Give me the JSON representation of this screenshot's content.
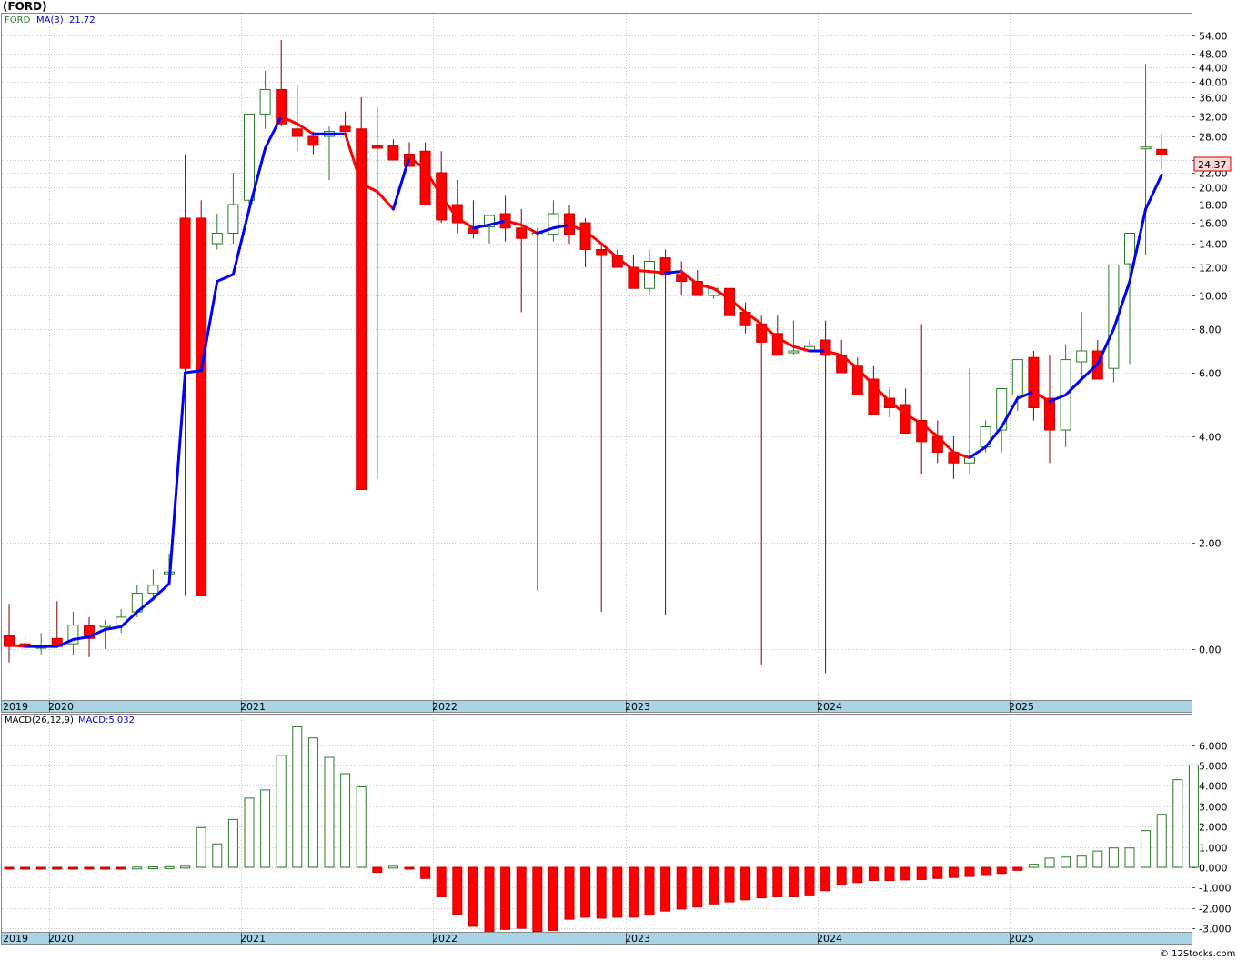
{
  "header": {
    "symbol": "(FORD)"
  },
  "legend": {
    "ticker": "FORD",
    "ma_label": "MA(3)",
    "ma_value": "21.72",
    "macd_params": "MACD(26,12,9)",
    "macd_value": "MACD:5.032"
  },
  "last_price": "24.37",
  "watermark": "© 12Stocks.com",
  "colors": {
    "up": "#2a7a2a",
    "down": "#ff0000",
    "ma_up": "#0000ff",
    "ma_down": "#ff0000",
    "axis_band": "#a8d4e6"
  },
  "chart_data": [
    {
      "type": "candlestick",
      "title": "(FORD)",
      "price_ticks": [
        "54.00",
        "48.00",
        "44.00",
        "40.00",
        "36.00",
        "32.00",
        "28.00",
        "24.00",
        "22.00",
        "20.00",
        "18.00",
        "16.00",
        "14.00",
        "12.00",
        "10.00",
        "8.00",
        "6.00",
        "4.00",
        "2.00",
        "0.00"
      ],
      "price_tick_values": [
        54,
        48,
        44,
        40,
        36,
        32,
        28,
        24,
        22,
        20,
        18,
        16,
        14,
        12,
        10,
        8,
        6,
        4,
        2,
        0
      ],
      "year_labels": [
        {
          "label": "2019",
          "month": 0
        },
        {
          "label": "2020",
          "month": 3
        },
        {
          "label": "2021",
          "month": 15
        },
        {
          "label": "2022",
          "month": 27
        },
        {
          "label": "2023",
          "month": 39
        },
        {
          "label": "2024",
          "month": 51
        },
        {
          "label": "2025",
          "month": 63
        }
      ],
      "x_range": [
        "2019-10",
        "2025-10"
      ],
      "months": [
        "2019-10",
        "2019-11",
        "2019-12",
        "2020-01",
        "2020-02",
        "2020-03",
        "2020-04",
        "2020-05",
        "2020-06",
        "2020-07",
        "2020-08",
        "2020-09",
        "2020-10",
        "2020-11",
        "2020-12",
        "2021-01",
        "2021-02",
        "2021-03",
        "2021-04",
        "2021-05",
        "2021-06",
        "2021-07",
        "2021-08",
        "2021-09",
        "2021-10",
        "2021-11",
        "2021-12",
        "2022-01",
        "2022-02",
        "2022-03",
        "2022-04",
        "2022-05",
        "2022-06",
        "2022-07",
        "2022-08",
        "2022-09",
        "2022-10",
        "2022-11",
        "2022-12",
        "2023-01",
        "2023-02",
        "2023-03",
        "2023-04",
        "2023-05",
        "2023-06",
        "2023-07",
        "2023-08",
        "2023-09",
        "2023-10",
        "2023-11",
        "2023-12",
        "2024-01",
        "2024-02",
        "2024-03",
        "2024-04",
        "2024-05",
        "2024-06",
        "2024-07",
        "2024-08",
        "2024-09",
        "2024-10",
        "2024-11",
        "2024-12",
        "2025-01",
        "2025-02",
        "2025-03",
        "2025-04",
        "2025-05",
        "2025-06",
        "2025-07",
        "2025-08",
        "2025-09",
        "2025-10"
      ],
      "open": [
        0.25,
        0.1,
        0.05,
        0.2,
        0.1,
        0.45,
        0.45,
        0.45,
        0.7,
        1.05,
        1.45,
        16.5,
        16.5,
        14.0,
        15.0,
        18.5,
        32.5,
        38.0,
        29.5,
        28.0,
        28.0,
        30.0,
        29.5,
        26.5,
        26.5,
        25.0,
        25.5,
        22.0,
        18.0,
        15.5,
        15.6,
        17.0,
        15.5,
        15.0,
        14.9,
        17.0,
        16.0,
        13.5,
        13.0,
        12.0,
        10.5,
        12.8,
        11.5,
        11.0,
        10.0,
        10.5,
        9.0,
        8.3,
        7.8,
        7.0,
        7.0,
        7.5,
        6.8,
        6.3,
        5.8,
        5.2,
        5.0,
        4.5,
        4.0,
        3.7,
        3.5,
        3.8,
        4.2,
        5.3,
        6.7,
        5.2,
        4.2,
        6.5,
        7.0,
        6.2,
        12.3,
        26.0,
        25.8
      ],
      "high": [
        0.85,
        0.25,
        0.3,
        0.9,
        0.7,
        0.6,
        0.55,
        0.75,
        1.2,
        1.5,
        1.8,
        25.0,
        18.5,
        17.0,
        22.0,
        31.0,
        43.0,
        52.5,
        39.0,
        29.0,
        30.0,
        33.0,
        36.0,
        34.0,
        27.5,
        27.0,
        27.0,
        25.5,
        21.0,
        18.5,
        16.8,
        19.0,
        17.5,
        15.5,
        18.5,
        18.0,
        16.5,
        14.0,
        13.5,
        13.0,
        13.5,
        13.5,
        12.5,
        11.8,
        10.5,
        10.5,
        9.6,
        8.8,
        8.8,
        8.5,
        7.5,
        8.5,
        7.5,
        6.7,
        6.3,
        5.5,
        5.5,
        8.3,
        4.5,
        4.0,
        6.2,
        4.5,
        4.6,
        6.5,
        7.0,
        6.8,
        7.3,
        9.0,
        7.5,
        6.8,
        12.5,
        45.0,
        28.5
      ],
      "low": [
        -0.25,
        0.0,
        -0.1,
        0.1,
        -0.1,
        -0.15,
        0.0,
        0.3,
        0.6,
        0.9,
        1.2,
        1.0,
        1.8,
        13.5,
        14.0,
        18.0,
        29.5,
        30.0,
        25.5,
        25.0,
        21.0,
        28.0,
        27.0,
        3.2,
        25.0,
        24.5,
        22.5,
        16.0,
        15.0,
        14.5,
        14.0,
        14.2,
        9.0,
        1.1,
        14.2,
        14.0,
        12.0,
        0.7,
        12.0,
        11.0,
        10.0,
        0.65,
        10.0,
        10.2,
        9.8,
        9.0,
        7.8,
        -0.3,
        7.0,
        6.8,
        7.0,
        -0.45,
        6.0,
        6.0,
        4.8,
        4.6,
        4.3,
        3.3,
        3.5,
        3.2,
        3.3,
        3.7,
        3.7,
        4.8,
        4.5,
        3.5,
        3.8,
        5.8,
        6.2,
        5.7,
        6.4,
        13.0,
        22.5
      ],
      "close": [
        0.05,
        0.05,
        0.05,
        0.05,
        0.45,
        0.2,
        0.45,
        0.6,
        1.05,
        1.2,
        1.45,
        6.2,
        1.0,
        15.0,
        18.0,
        32.5,
        38.0,
        30.5,
        28.0,
        26.5,
        29.0,
        29.0,
        3.0,
        26.0,
        24.0,
        23.0,
        18.0,
        16.3,
        16.0,
        15.0,
        16.8,
        15.5,
        14.5,
        15.0,
        17.0,
        14.9,
        13.5,
        13.0,
        12.0,
        10.5,
        12.5,
        11.5,
        11.0,
        10.0,
        10.5,
        8.8,
        8.2,
        7.4,
        6.8,
        7.0,
        7.2,
        6.8,
        6.0,
        5.3,
        4.7,
        4.9,
        4.1,
        3.9,
        3.7,
        3.5,
        3.6,
        4.3,
        5.5,
        6.6,
        4.9,
        4.2,
        6.6,
        7.0,
        5.8,
        12.2,
        15.0,
        26.2,
        25.0
      ],
      "ma": [
        0.08,
        0.05,
        0.05,
        0.05,
        0.18,
        0.23,
        0.37,
        0.42,
        0.7,
        0.95,
        1.23,
        6.0,
        6.1,
        11.0,
        11.5,
        17.5,
        26.0,
        32.0,
        30.5,
        28.5,
        28.5,
        28.5,
        20.5,
        19.5,
        17.5,
        24.5,
        22.5,
        19.0,
        16.5,
        15.5,
        15.8,
        16.2,
        15.8,
        15.0,
        15.5,
        15.8,
        15.2,
        14.0,
        12.8,
        11.8,
        11.7,
        11.6,
        11.7,
        10.8,
        10.5,
        9.8,
        9.0,
        8.3,
        7.6,
        7.2,
        7.0,
        7.0,
        6.8,
        6.2,
        5.6,
        5.1,
        4.7,
        4.4,
        4.0,
        3.7,
        3.6,
        3.8,
        4.3,
        5.2,
        5.4,
        5.1,
        5.3,
        5.8,
        6.4,
        8.0,
        11.0,
        17.5,
        21.72
      ]
    },
    {
      "type": "bar",
      "title": "MACD(26,12,9)",
      "ticks": [
        "6.000",
        "5.000",
        "4.000",
        "3.000",
        "2.000",
        "1.000",
        "0.000",
        "-1.000",
        "-2.000",
        "-3.000"
      ],
      "tick_values": [
        6,
        5,
        4,
        3,
        2,
        1,
        0,
        -1,
        -2,
        -3
      ],
      "ylim": [
        -3.2,
        6.6
      ],
      "values": [
        -0.05,
        -0.05,
        -0.05,
        -0.05,
        -0.04,
        -0.04,
        -0.03,
        -0.02,
        0.01,
        0.02,
        0.03,
        0.05,
        1.95,
        1.15,
        2.35,
        3.4,
        3.8,
        5.5,
        6.9,
        6.35,
        5.4,
        4.6,
        3.95,
        -0.25,
        0.05,
        -0.02,
        -0.55,
        -1.45,
        -2.3,
        -2.9,
        -3.2,
        -3.05,
        -3.0,
        -3.15,
        -3.1,
        -2.55,
        -2.45,
        -2.5,
        -2.45,
        -2.45,
        -2.35,
        -2.15,
        -2.05,
        -1.95,
        -1.8,
        -1.7,
        -1.6,
        -1.5,
        -1.45,
        -1.45,
        -1.4,
        -1.15,
        -0.85,
        -0.75,
        -0.65,
        -0.65,
        -0.62,
        -0.6,
        -0.55,
        -0.5,
        -0.45,
        -0.4,
        -0.3,
        -0.15,
        0.15,
        0.45,
        0.5,
        0.55,
        0.8,
        0.95,
        0.95,
        1.8,
        2.6,
        4.3,
        5.03
      ]
    }
  ]
}
